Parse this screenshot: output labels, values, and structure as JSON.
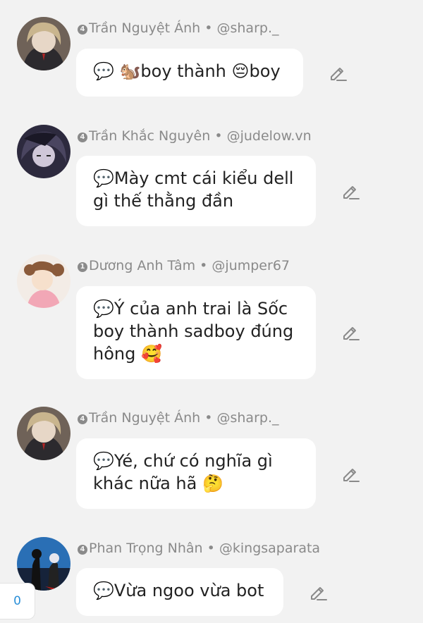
{
  "comments": [
    {
      "badge": "4",
      "author": "Trần Nguyệt Ánh",
      "handle": "@sharp._",
      "text_lines": [
        "💬 🐿️boy thành 😔boy"
      ]
    },
    {
      "badge": "4",
      "author": "Trần Khắc Nguyên",
      "handle": "@judelow.vn",
      "text_lines": [
        "💬Mày cmt cái kiểu dell",
        "gì thế thằng đần"
      ]
    },
    {
      "badge": "1",
      "author": "Dương Anh Tâm",
      "handle": "@jumper67",
      "text_lines": [
        "💬Ý của anh trai là Sốc",
        "boy thành sadboy đúng",
        "hông 🥰"
      ]
    },
    {
      "badge": "4",
      "author": "Trần Nguyệt Ánh",
      "handle": "@sharp._",
      "text_lines": [
        "💬Yé, chứ có nghĩa gì",
        "khác nữa hã 🤔"
      ]
    },
    {
      "badge": "4",
      "author": "Phan Trọng Nhân",
      "handle": "@kingsaparata",
      "text_lines": [
        "💬Vừa ngoo vừa bot"
      ]
    }
  ],
  "separator": "•",
  "counter": "0",
  "icons": {
    "edit": "pencil-edit-icon"
  },
  "colors": {
    "background": "#f2f2f2",
    "bubble": "#ffffff",
    "meta_text": "#8a8a8a",
    "counter_text": "#2a8fd8"
  }
}
